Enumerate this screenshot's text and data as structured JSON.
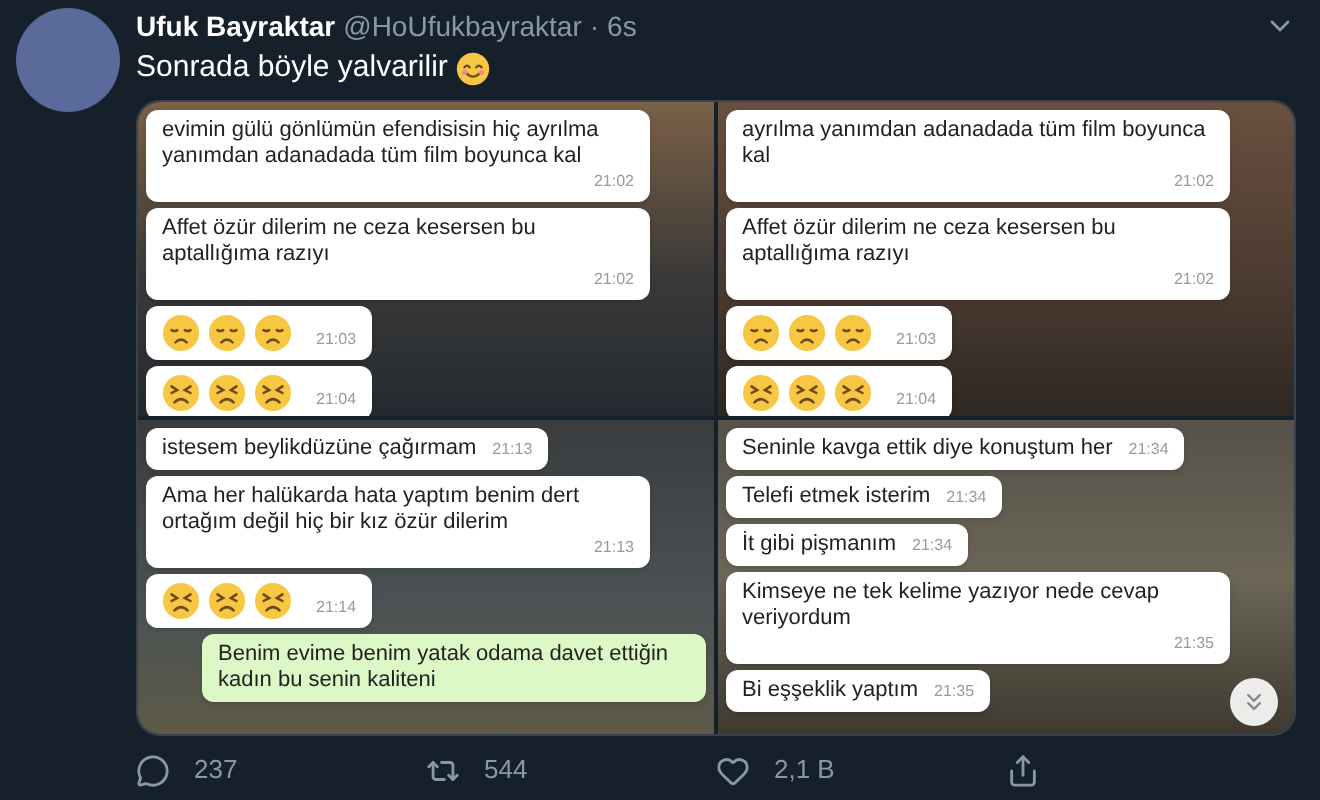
{
  "tweet": {
    "author": "Ufuk Bayraktar",
    "handle": "@HoUfukbayraktar",
    "separator": "·",
    "time": "6s",
    "text": "Sonrada böyle yalvarilir"
  },
  "panels": [
    {
      "bubbles": [
        {
          "kind": "text",
          "sent": false,
          "text": "evimin gülü gönlümün efendisisin hiç ayrılma yanımdan adanadada tüm film boyunca kal",
          "time": "21:02"
        },
        {
          "kind": "text",
          "sent": false,
          "text": "Affet özür dilerim ne ceza kesersen bu aptallığıma razıyı",
          "time": "21:02"
        },
        {
          "kind": "sad",
          "sent": false,
          "time": "21:03"
        },
        {
          "kind": "persevere",
          "sent": false,
          "time": "21:04"
        }
      ]
    },
    {
      "bubbles": [
        {
          "kind": "text",
          "sent": false,
          "text": "ayrılma yanımdan adanadada tüm film boyunca kal",
          "time": "21:02"
        },
        {
          "kind": "text",
          "sent": false,
          "text": "Affet özür dilerim ne ceza kesersen bu aptallığıma razıyı",
          "time": "21:02"
        },
        {
          "kind": "sad",
          "sent": false,
          "time": "21:03"
        },
        {
          "kind": "persevere",
          "sent": false,
          "time": "21:04"
        }
      ]
    },
    {
      "bubbles": [
        {
          "kind": "text",
          "sent": false,
          "text": "istesem beylikdüzüne çağırmam",
          "time": "21:13"
        },
        {
          "kind": "text",
          "sent": false,
          "text": "Ama her halükarda hata yaptım benim dert ortağım değil hiç bir kız özür dilerim",
          "time": "21:13"
        },
        {
          "kind": "persevere",
          "sent": false,
          "time": "21:14"
        },
        {
          "kind": "text",
          "sent": true,
          "text": "Benim evime benim yatak odama davet ettiğin kadın bu senin kaliteni"
        }
      ]
    },
    {
      "bubbles": [
        {
          "kind": "text",
          "sent": false,
          "text": "Seninle kavga ettik diye konuştum her",
          "time": "21:34"
        },
        {
          "kind": "text",
          "sent": false,
          "text": "Telefi etmek isterim",
          "time": "21:34"
        },
        {
          "kind": "text",
          "sent": false,
          "text": "İt gibi pişmanım",
          "time": "21:34"
        },
        {
          "kind": "text",
          "sent": false,
          "text": "Kimseye ne tek kelime yazıyor nede cevap veriyordum",
          "time": "21:35"
        },
        {
          "kind": "text",
          "sent": false,
          "text": "Bi eşşeklik yaptım",
          "time": "21:35"
        }
      ],
      "scroll_button": true
    }
  ],
  "actions": [
    {
      "kind": "reply",
      "count": "237"
    },
    {
      "kind": "retweet",
      "count": "544"
    },
    {
      "kind": "like",
      "count": "2,1 B"
    },
    {
      "kind": "share"
    }
  ]
}
